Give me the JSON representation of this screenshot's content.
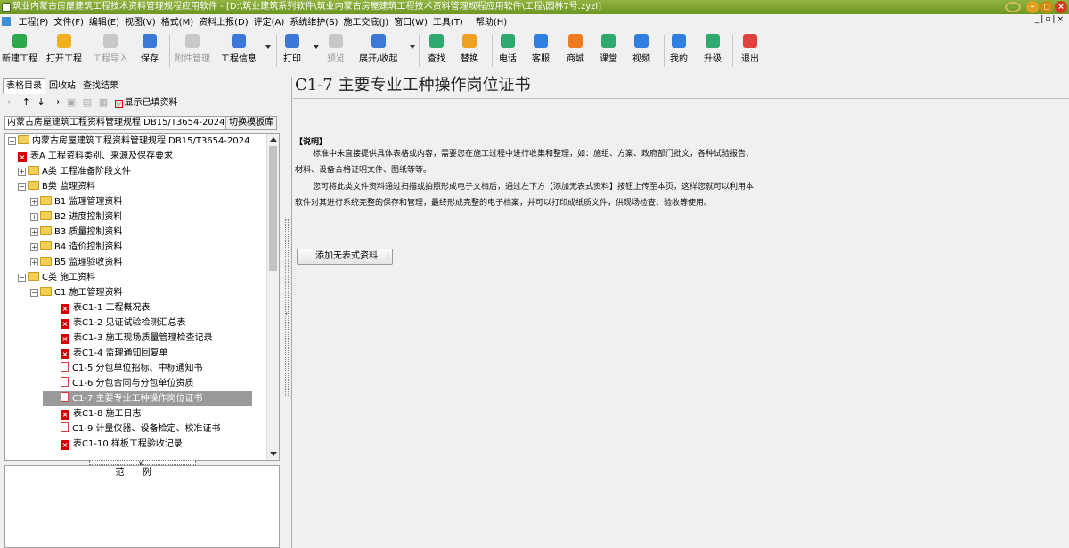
{
  "window": {
    "title": "筑业内蒙古房屋建筑工程技术资料管理规程应用软件 - [D:\\筑业建筑系列软件\\筑业内蒙古房屋建筑工程技术资料管理规程应用软件\\工程\\园林7号.zyzl]"
  },
  "menu": [
    {
      "label": "工程(P)"
    },
    {
      "label": "文件(F)"
    },
    {
      "label": "编辑(E)"
    },
    {
      "label": "视图(V)"
    },
    {
      "label": "格式(M)"
    },
    {
      "label": "资料上报(D)"
    },
    {
      "label": "评定(A)"
    },
    {
      "label": "系统维护(S)"
    },
    {
      "label": "施工交底(J)"
    },
    {
      "label": "窗口(W)"
    },
    {
      "label": "工具(T)"
    },
    {
      "label": "帮助(H)"
    }
  ],
  "toolbar": [
    {
      "label": "新建工程",
      "icon": "plus-icon",
      "color": "#2ea84a"
    },
    {
      "label": "打开工程",
      "icon": "folder-open-icon",
      "color": "#f0b020"
    },
    {
      "label": "工程导入",
      "icon": "import-icon",
      "color": "#c8c8c8",
      "disabled": true
    },
    {
      "label": "保存",
      "icon": "save-icon",
      "color": "#3b78d8"
    },
    {
      "label": "附件管理",
      "icon": "attachment-icon",
      "color": "#c8c8c8",
      "disabled": true
    },
    {
      "label": "工程信息",
      "icon": "info-list-icon",
      "color": "#3b78d8"
    },
    {
      "label": "打印",
      "icon": "printer-icon",
      "color": "#3b78d8"
    },
    {
      "label": "预览",
      "icon": "preview-icon",
      "color": "#c8c8c8",
      "disabled": true
    },
    {
      "label": "展开/收起",
      "icon": "expand-plus-icon",
      "color": "#3b78d8"
    },
    {
      "label": "查找",
      "icon": "search-icon",
      "color": "#2eaa6e"
    },
    {
      "label": "替换",
      "icon": "replace-icon",
      "color": "#f0a020"
    },
    {
      "label": "电话",
      "icon": "phone-icon",
      "color": "#2eaa6e"
    },
    {
      "label": "客服",
      "icon": "headset-icon",
      "color": "#2f7ee0"
    },
    {
      "label": "商城",
      "icon": "shop-icon",
      "color": "#f07a20"
    },
    {
      "label": "课堂",
      "icon": "graduation-cap-icon",
      "color": "#2eaa6e"
    },
    {
      "label": "视频",
      "icon": "play-icon",
      "color": "#2f7ee0"
    },
    {
      "label": "我的",
      "icon": "user-icon",
      "color": "#2f7ee0"
    },
    {
      "label": "升级",
      "icon": "upgrade-icon",
      "color": "#2eaa6e"
    },
    {
      "label": "退出",
      "icon": "power-icon",
      "color": "#e04040"
    }
  ],
  "left_panel": {
    "tabs": [
      "表格目录",
      "回收站",
      "查找结果"
    ],
    "show_filled_label": "显示已填资料",
    "spec_name": "内蒙古房屋建筑工程资料管理规程 DB15/T3654-2024",
    "switch_template_label": "切换模板库",
    "example_title": "范例"
  },
  "tree": [
    {
      "text": "内蒙古房屋建筑工程资料管理规程 DB15/T3654-2024",
      "level": 0,
      "kind": "folder",
      "exp": "−"
    },
    {
      "text": "表A 工程资料类别、来源及保存要求",
      "level": 1,
      "kind": "red"
    },
    {
      "text": "A类 工程准备阶段文件",
      "level": 1,
      "kind": "folder",
      "exp": "+"
    },
    {
      "text": "B类 监理资料",
      "level": 1,
      "kind": "folder",
      "exp": "−"
    },
    {
      "text": "B1 监理管理资料",
      "level": 2,
      "kind": "folder",
      "exp": "+"
    },
    {
      "text": "B2 进度控制资料",
      "level": 2,
      "kind": "folder",
      "exp": "+"
    },
    {
      "text": "B3 质量控制资料",
      "level": 2,
      "kind": "folder",
      "exp": "+"
    },
    {
      "text": "B4 造价控制资料",
      "level": 2,
      "kind": "folder",
      "exp": "+"
    },
    {
      "text": "B5 监理验收资料",
      "level": 2,
      "kind": "folder",
      "exp": "+"
    },
    {
      "text": "C类 施工资料",
      "level": 1,
      "kind": "folder",
      "exp": "−"
    },
    {
      "text": "C1 施工管理资料",
      "level": 2,
      "kind": "folder",
      "exp": "−"
    },
    {
      "text": "表C1-1 工程概况表",
      "level": 3,
      "kind": "red"
    },
    {
      "text": "表C1-2 见证试验检测汇总表",
      "level": 3,
      "kind": "red"
    },
    {
      "text": "表C1-3 施工现场质量管理检查记录",
      "level": 3,
      "kind": "red"
    },
    {
      "text": "表C1-4 监理通知回复单",
      "level": 3,
      "kind": "red"
    },
    {
      "text": "C1-5 分包单位招标、中标通知书",
      "level": 3,
      "kind": "doc"
    },
    {
      "text": "C1-6 分包合同与分包单位资质",
      "level": 3,
      "kind": "doc"
    },
    {
      "text": "C1-7 主要专业工种操作岗位证书",
      "level": 3,
      "kind": "doc",
      "selected": true
    },
    {
      "text": "表C1-8 施工日志",
      "level": 3,
      "kind": "red"
    },
    {
      "text": "C1-9 计量仪器、设备检定、校准证书",
      "level": 3,
      "kind": "doc"
    },
    {
      "text": "表C1-10 样板工程验收记录",
      "level": 3,
      "kind": "red"
    }
  ],
  "content": {
    "title": "C1-7 主要专业工种操作岗位证书",
    "desc_heading": "【说明】",
    "para1": "标准中未直接提供具体表格或内容，需要您在施工过程中进行收集和整理，如：施组、方案、政府部门批文，各种试验报告、",
    "para2": "材料、设备合格证明文件、图纸等等。",
    "para3": "您可将此类文件资料通过扫描或拍照形成电子文档后，通过左下方【添加无表式资料】按钮上传至本页，这样您就可以利用本",
    "para4": "软件对其进行系统完整的保存和管理，最终形成完整的电子档案，并可以打印成纸质文件，供现场检查、验收等使用。",
    "add_button": "添加无表式资料"
  }
}
